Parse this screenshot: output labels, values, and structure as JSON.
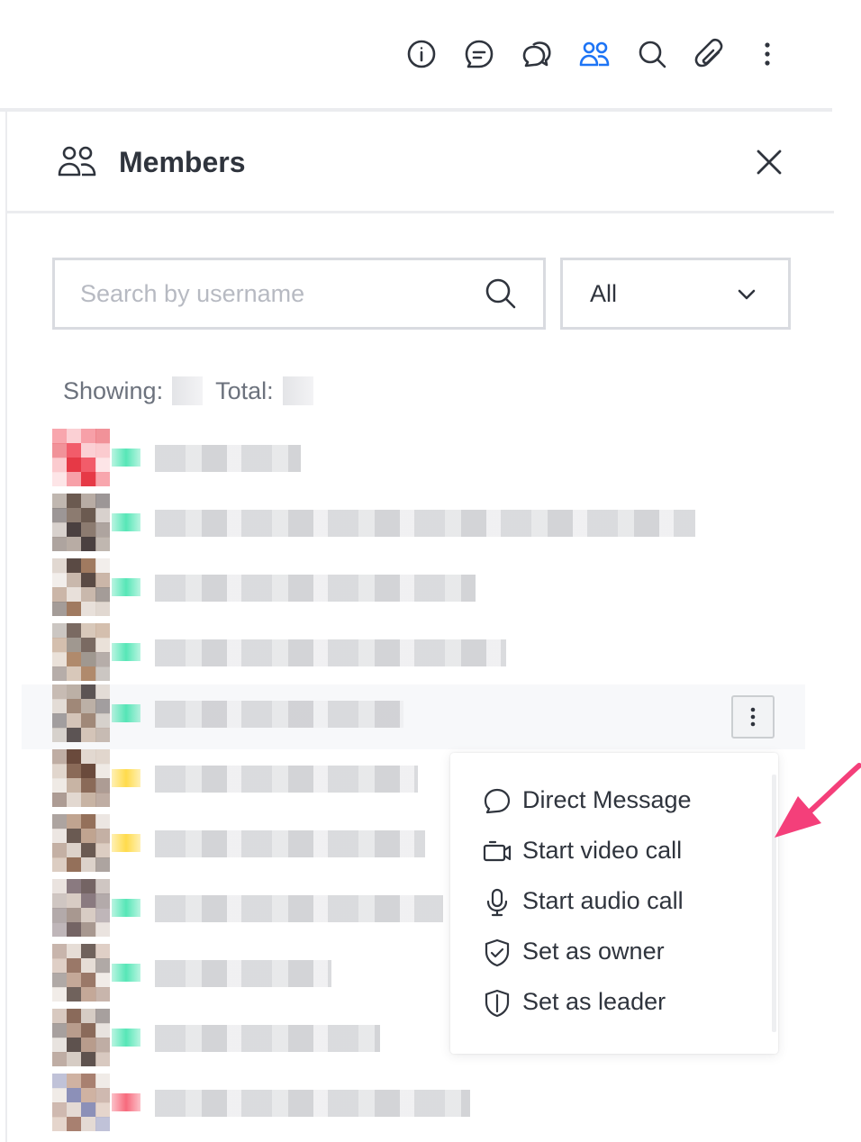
{
  "toolbar": {
    "icons": [
      "info-icon",
      "threads-icon",
      "discussion-icon",
      "members-icon",
      "search-icon",
      "attachment-icon",
      "kebab-menu-icon"
    ],
    "active_icon": "members-icon",
    "active_color": "#1d74f5"
  },
  "panel": {
    "title": "Members",
    "icon": "members-icon",
    "close_icon": "close-icon"
  },
  "search": {
    "placeholder": "Search by username",
    "value": ""
  },
  "filter": {
    "selected": "All"
  },
  "counts": {
    "showing_label": "Showing:",
    "total_label": "Total:"
  },
  "members": {
    "rows": [
      {
        "status_color": "#2de0a5"
      },
      {
        "status_color": "#2de0a5"
      },
      {
        "status_color": "#2de0a5"
      },
      {
        "status_color": "#2de0a5"
      },
      {
        "status_color": "#2de0a5"
      },
      {
        "status_color": "#ffd21f"
      },
      {
        "status_color": "#ffd21f"
      },
      {
        "status_color": "#2de0a5"
      },
      {
        "status_color": "#2de0a5"
      },
      {
        "status_color": "#2de0a5"
      },
      {
        "status_color": "#f5455c"
      }
    ]
  },
  "context_menu": {
    "items": [
      {
        "label": "Direct Message",
        "icon": "chat-bubble-icon"
      },
      {
        "label": "Start video call",
        "icon": "video-camera-icon"
      },
      {
        "label": "Start audio call",
        "icon": "microphone-icon"
      },
      {
        "label": "Set as owner",
        "icon": "shield-check-icon"
      },
      {
        "label": "Set as leader",
        "icon": "shield-blank-icon"
      }
    ]
  },
  "annotation": {
    "arrow_color": "#f43f7a"
  }
}
